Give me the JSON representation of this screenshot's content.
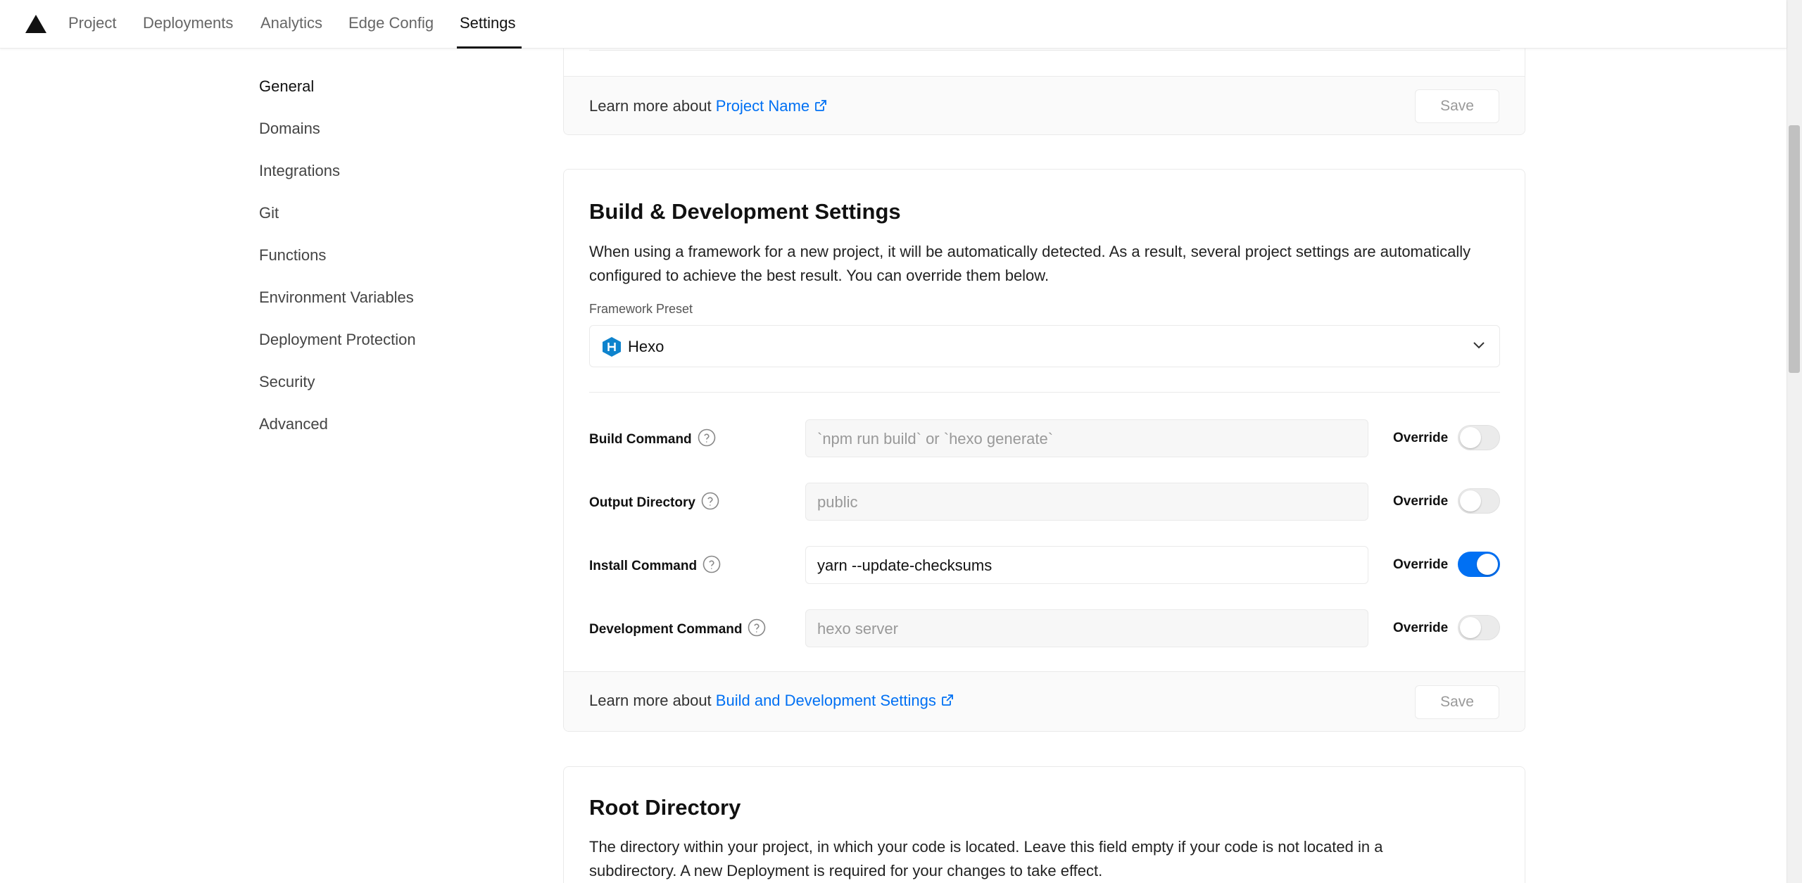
{
  "nav": {
    "tabs": [
      {
        "label": "Project"
      },
      {
        "label": "Deployments"
      },
      {
        "label": "Analytics"
      },
      {
        "label": "Edge Config"
      },
      {
        "label": "Settings"
      }
    ],
    "active_tab": "Settings"
  },
  "sidebar": {
    "items": [
      {
        "label": "General"
      },
      {
        "label": "Domains"
      },
      {
        "label": "Integrations"
      },
      {
        "label": "Git"
      },
      {
        "label": "Functions"
      },
      {
        "label": "Environment Variables"
      },
      {
        "label": "Deployment Protection"
      },
      {
        "label": "Security"
      },
      {
        "label": "Advanced"
      }
    ],
    "active_item": "General"
  },
  "project_name_card": {
    "learn_prefix": "Learn more about",
    "learn_link": "Project Name",
    "save_label": "Save"
  },
  "build_card": {
    "title": "Build & Development Settings",
    "description": "When using a framework for a new project, it will be automatically detected. As a result, several project settings are automatically configured to achieve the best result. You can override them below.",
    "framework_label": "Framework Preset",
    "framework_value": "Hexo",
    "override_label": "Override",
    "rows": [
      {
        "label": "Build Command",
        "value": "`npm run build` or `hexo generate`",
        "override": false
      },
      {
        "label": "Output Directory",
        "value": "public",
        "override": false
      },
      {
        "label": "Install Command",
        "value": "yarn --update-checksums",
        "override": true
      },
      {
        "label": "Development Command",
        "value": "hexo server",
        "override": false
      }
    ],
    "learn_prefix": "Learn more about",
    "learn_link": "Build and Development Settings",
    "save_label": "Save"
  },
  "root_card": {
    "title": "Root Directory",
    "description": "The directory within your project, in which your code is located. Leave this field empty if your code is not located in a subdirectory. A new Deployment is required for your changes to take effect."
  },
  "colors": {
    "accent": "#0070f3",
    "hexo_icon": "#0e83cd"
  }
}
